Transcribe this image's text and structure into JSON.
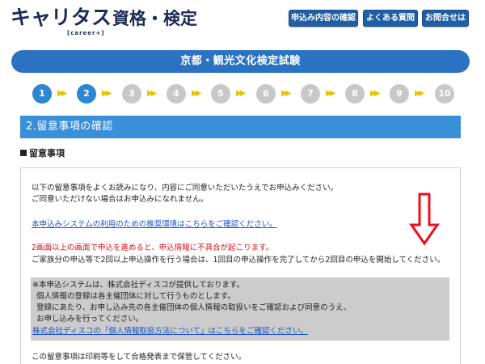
{
  "header": {
    "logo_main": "キャリタス資格・検定",
    "logo_kana": "キャリタス",
    "logo_kanji": "資格・検定",
    "logo_sub": "[career+]",
    "nav": [
      {
        "label": "申込み内容の確認"
      },
      {
        "label": "よくある質問"
      },
      {
        "label": "お問合せは"
      }
    ]
  },
  "title": "京都・観光文化検定試験",
  "steps": {
    "items": [
      "1",
      "2",
      "3",
      "4",
      "5",
      "6",
      "7",
      "8",
      "9",
      "10"
    ],
    "current": 2,
    "arrow_glyph": "▶▶",
    "active_color": "#2b86d3",
    "inactive_color": "#c8c8c8",
    "arrow_color": "#e8c400"
  },
  "section": {
    "title": "2.留意事項の確認",
    "subheading": "留意事項"
  },
  "content": {
    "line1": "以下の留意事項をよくお読みになり、内容にご同意いただいたうえでお申込みください。",
    "line2": "ご同意いただけない場合はお申込みになれません。",
    "link1": "本申込みシステムの利用のための推奨環境はこちらをご確認ください。",
    "warning": "2画面以上の画面で申込を進めると、申込情報に不具合が起こります。",
    "line3": "ご家族分の申込等で2回以上申込操作を行う場合は、1回目の申込操作を完了してから2回目の申込を開始してください。",
    "notice": {
      "line1": "※本申込システムは、株式会社ディスコが提供しております。",
      "line2": "個人情報の登録は各主催団体に対して行うものとします。",
      "line3": "登録にあたり、お申し込み先の各主催団体の個人情報の取扱いをご確認および同意のうえ、",
      "line4": "お申し込みを行ってください。",
      "link": "株式会社ディスコの「個人情報取扱方法について」はこちらをご確認ください。"
    },
    "line4": "この留意事項は印刷等をして合格発表まで保管してください。"
  },
  "colors": {
    "brand_navy": "#1d2a57",
    "button_blue": "#1f5fa6",
    "title_blue": "#2b72c2",
    "section_blue": "#3a8fd9",
    "link_blue": "#1a53c6",
    "warning_red": "#e0101a",
    "notice_gray": "#cccccc",
    "annotation_red": "#e8111c"
  },
  "icons": {
    "annotation": "down-arrow-outline-icon",
    "step_separator": "double-chevron-right-icon"
  }
}
